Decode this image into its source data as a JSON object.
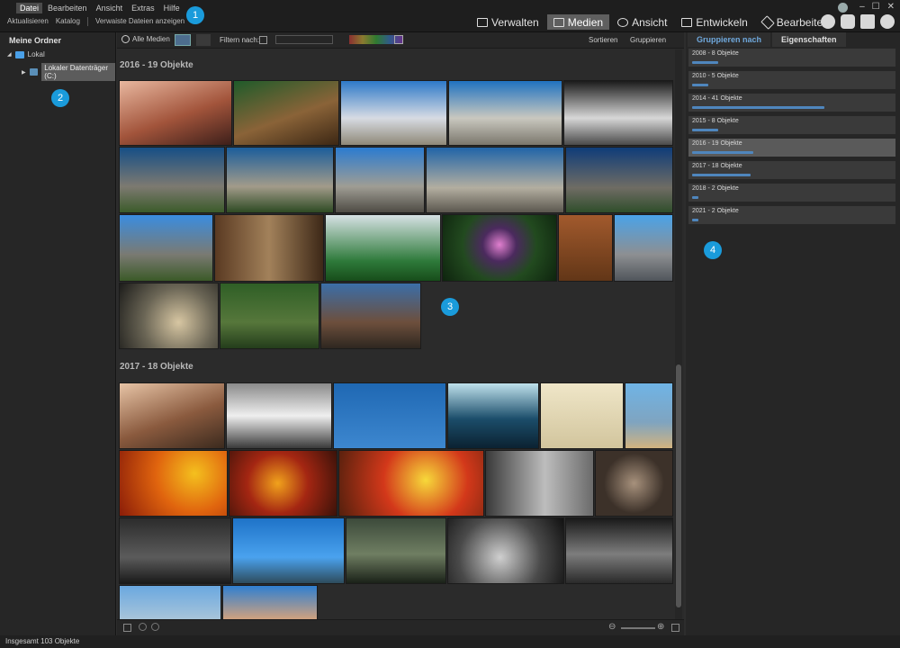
{
  "menu": [
    "Datei",
    "Bearbeiten",
    "Ansicht",
    "Extras",
    "Hilfe"
  ],
  "toolbar": {
    "refresh": "Aktualisieren",
    "catalog": "Katalog",
    "orphans": "Verwaiste Dateien anzeigen"
  },
  "modes": [
    {
      "label": "Verwalten",
      "active": false
    },
    {
      "label": "Medien",
      "active": true
    },
    {
      "label": "Ansicht",
      "active": false
    },
    {
      "label": "Entwickeln",
      "active": false
    },
    {
      "label": "Bearbeiten",
      "active": false
    }
  ],
  "window_controls": [
    "–",
    "☐",
    "✕"
  ],
  "folders": {
    "title": "Meine Ordner",
    "local": "Lokal",
    "drive": "Lokaler Datenträger (C:)"
  },
  "center": {
    "all_media": "Alle Medien",
    "filter_label": "Filtern nach:",
    "sort": "Sortieren",
    "group": "Gruppieren"
  },
  "groups": [
    {
      "title": "2016 - 19 Objekte"
    },
    {
      "title": "2017 - 18 Objekte"
    }
  ],
  "right": {
    "tabs": [
      {
        "label": "Gruppieren nach",
        "active": true
      },
      {
        "label": "Eigenschaften",
        "active": false
      }
    ],
    "groups": [
      {
        "label": "2008 - 8 Objekte",
        "count": 8,
        "active": false
      },
      {
        "label": "2010 - 5 Objekte",
        "count": 5,
        "active": false
      },
      {
        "label": "2014 - 41 Objekte",
        "count": 41,
        "active": false
      },
      {
        "label": "2015 - 8 Objekte",
        "count": 8,
        "active": false
      },
      {
        "label": "2016 - 19 Objekte",
        "count": 19,
        "active": true
      },
      {
        "label": "2017 - 18 Objekte",
        "count": 18,
        "active": false
      },
      {
        "label": "2018 - 2 Objekte",
        "count": 2,
        "active": false
      },
      {
        "label": "2021 - 2 Objekte",
        "count": 2,
        "active": false
      }
    ]
  },
  "status": "Insgesamt 103 Objekte",
  "badges": [
    "1",
    "2",
    "3",
    "4"
  ]
}
